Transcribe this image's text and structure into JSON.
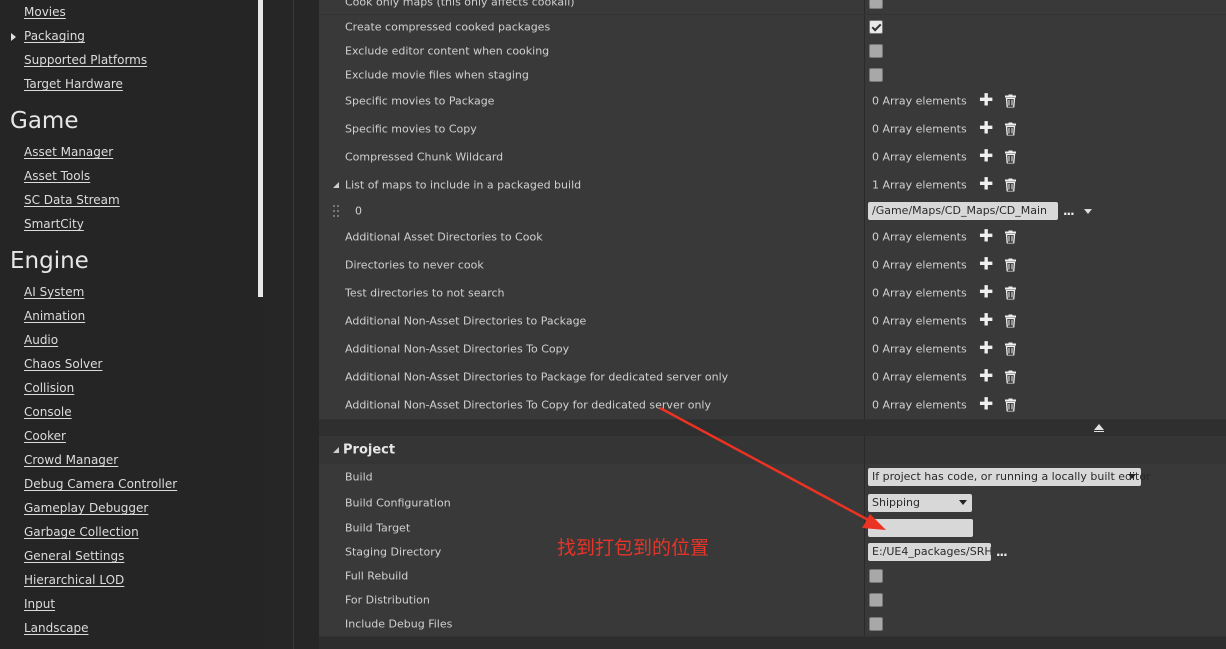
{
  "sidebar": {
    "items_top": [
      {
        "label": "Movies"
      },
      {
        "label": "Packaging"
      },
      {
        "label": "Supported Platforms"
      },
      {
        "label": "Target Hardware"
      }
    ],
    "game_header": "Game",
    "game_items": [
      {
        "label": "Asset Manager"
      },
      {
        "label": "Asset Tools"
      },
      {
        "label": "SC Data Stream"
      },
      {
        "label": "SmartCity"
      }
    ],
    "engine_header": "Engine",
    "engine_items": [
      {
        "label": "AI System"
      },
      {
        "label": "Animation"
      },
      {
        "label": "Audio"
      },
      {
        "label": "Chaos Solver"
      },
      {
        "label": "Collision"
      },
      {
        "label": "Console"
      },
      {
        "label": "Cooker"
      },
      {
        "label": "Crowd Manager"
      },
      {
        "label": "Debug Camera Controller"
      },
      {
        "label": "Gameplay Debugger"
      },
      {
        "label": "Garbage Collection"
      },
      {
        "label": "General Settings"
      },
      {
        "label": "Hierarchical LOD"
      },
      {
        "label": "Input"
      },
      {
        "label": "Landscape"
      }
    ]
  },
  "packaging_rows": {
    "cook_only_maps": "Cook only maps (this only affects cookall)",
    "create_compressed": "Create compressed cooked packages",
    "exclude_editor": "Exclude editor content when cooking",
    "exclude_movie": "Exclude movie files when staging",
    "specific_movies_package": "Specific movies to Package",
    "specific_movies_copy": "Specific movies to Copy",
    "compressed_chunk": "Compressed Chunk Wildcard",
    "list_of_maps": "List of maps to include in a packaged build",
    "map_index": "0",
    "map_value": "/Game/Maps/CD_Maps/CD_Main",
    "additional_asset_dirs": "Additional Asset Directories to Cook",
    "never_cook": "Directories to never cook",
    "test_dirs": "Test directories to not search",
    "non_asset_package": "Additional Non-Asset Directories to Package",
    "non_asset_copy": "Additional Non-Asset Directories To Copy",
    "non_asset_package_server": "Additional Non-Asset Directories to Package for dedicated server only",
    "non_asset_copy_server": "Additional Non-Asset Directories To Copy for dedicated server only"
  },
  "array": {
    "zero": "0 Array elements",
    "one": "1 Array elements"
  },
  "project": {
    "title": "Project",
    "build_label": "Build",
    "build_value": "If project has code, or running a locally built editor",
    "build_config_label": "Build Configuration",
    "build_config_value": "Shipping",
    "build_target_label": "Build Target",
    "build_target_value": "",
    "staging_label": "Staging Directory",
    "staging_value": "E:/UE4_packages/SRH",
    "full_rebuild_label": "Full Rebuild",
    "distribution_label": "For Distribution",
    "debug_files_label": "Include Debug Files"
  },
  "annotation": {
    "text": "找到打包到的位置",
    "color": "#e53528"
  },
  "ellipsis": "..."
}
